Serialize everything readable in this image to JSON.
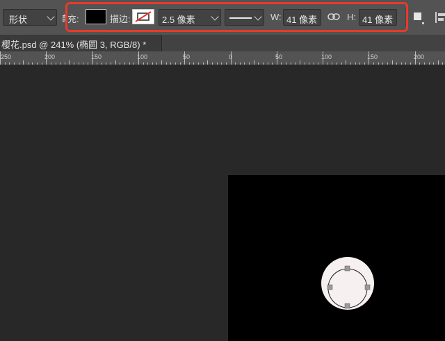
{
  "options_bar": {
    "mode_select": "形状",
    "fill_label": "填充:",
    "fill_color": "#000000",
    "stroke_label": "描边:",
    "stroke_width": "2.5 像素",
    "width_label": "W:",
    "width_value": "41 像素",
    "height_label": "H:",
    "height_value": "41 像素",
    "highlight_color": "#e53b2c"
  },
  "document_tab": {
    "title": "樱花.psd @ 241% (椭圆 3, RGB/8) *"
  },
  "ruler": {
    "labels": [
      "250",
      "200",
      "150",
      "100",
      "50",
      "0",
      "50",
      "100",
      "150",
      "200"
    ]
  },
  "canvas": {
    "background_color": "#000000",
    "shape_fill": "#f7f0f0",
    "shape_name": "椭圆 3"
  }
}
